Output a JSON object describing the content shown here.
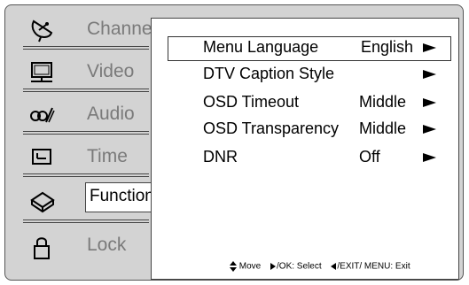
{
  "tabs": [
    {
      "label": "Channel",
      "icon": "satellite-dish-icon",
      "active": false
    },
    {
      "label": "Video",
      "icon": "monitor-icon",
      "active": false
    },
    {
      "label": "Audio",
      "icon": "dolby-audio-icon",
      "active": false
    },
    {
      "label": "Time",
      "icon": "clock-icon",
      "active": false
    },
    {
      "label": "Function",
      "icon": "toolbox-icon",
      "active": true
    },
    {
      "label": "Lock",
      "icon": "padlock-icon",
      "active": false
    }
  ],
  "menu": [
    {
      "name": "Menu Language",
      "value": "English",
      "selected": true
    },
    {
      "name": "DTV Caption Style",
      "value": "",
      "selected": false
    },
    {
      "name": "OSD Timeout",
      "value": "Middle",
      "selected": false
    },
    {
      "name": "OSD Transparency",
      "value": "Middle",
      "selected": false
    },
    {
      "name": "DNR",
      "value": "Off",
      "selected": false
    }
  ],
  "hints": {
    "move": "Move",
    "select": "/OK: Select",
    "exit": "/EXIT/ MENU: Exit"
  },
  "colors": {
    "panel": "#d3d3d3",
    "content": "#ffffff",
    "inactive_label": "#7a7a7a"
  }
}
